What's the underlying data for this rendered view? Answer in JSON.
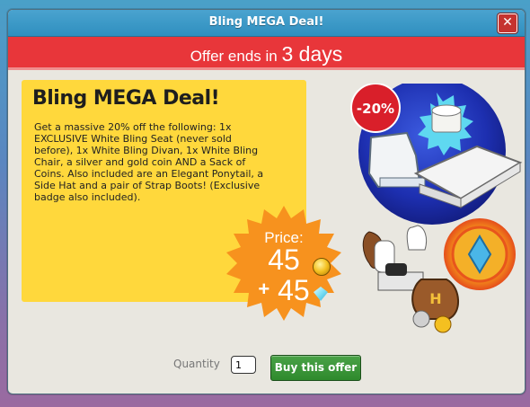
{
  "window": {
    "title": "Bling MEGA Deal!"
  },
  "banner": {
    "prefix": "Offer ends in ",
    "days": "3 days"
  },
  "offer": {
    "heading": "Bling MEGA Deal!",
    "description": "Get a massive 20% off the following: 1x EXCLUSIVE White Bling Seat (never sold before), 1x White Bling Divan, 1x White Bling Chair, a silver and gold coin AND a Sack of Coins. Also included are an Elegant Ponytail, a Side Hat and a pair of Strap Boots! (Exclusive badge also included).",
    "discount_badge": "-20%"
  },
  "price": {
    "label": "Price:",
    "credits": "45",
    "diamonds_prefix": "+",
    "diamonds": "45",
    "credits_icon": "gold-coin-icon",
    "diamonds_icon": "diamond-icon"
  },
  "purchase": {
    "quantity_label": "Quantity",
    "quantity_value": "1",
    "buy_label": "Buy this offer"
  },
  "colors": {
    "banner": "#e8363a",
    "panel": "#ffd83c",
    "price_badge": "#f7921e",
    "buy_button": "#3a9a37",
    "titlebar": "#3b9bc9"
  }
}
